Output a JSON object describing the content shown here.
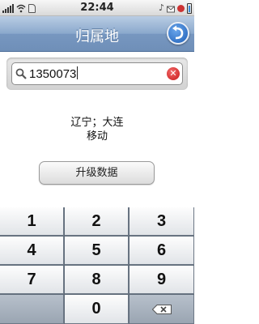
{
  "status_bar": {
    "time": "22:44",
    "left_icons": [
      "signal-icon",
      "wifi-icon",
      "sd-card-icon"
    ],
    "right_icons": [
      "music-note-icon",
      "notification-icon",
      "alarm-icon",
      "battery-icon"
    ]
  },
  "nav": {
    "title": "归属地",
    "back_icon": "back-arrow-icon"
  },
  "search": {
    "value": "1350073",
    "search_icon": "search-icon",
    "clear_icon": "clear-icon"
  },
  "result": {
    "location": "辽宁；大连",
    "carrier": "移动"
  },
  "upgrade_button": {
    "label": "升级数据"
  },
  "keypad": {
    "keys": [
      "1",
      "2",
      "3",
      "4",
      "5",
      "6",
      "7",
      "8",
      "9",
      "",
      "0",
      ""
    ],
    "delete_icon": "backspace-icon"
  },
  "colors": {
    "navbar": "#7797c0",
    "keypad_bg": "#5f6b79",
    "clear_button": "#c81818",
    "back_button": "#1f5fb6"
  }
}
